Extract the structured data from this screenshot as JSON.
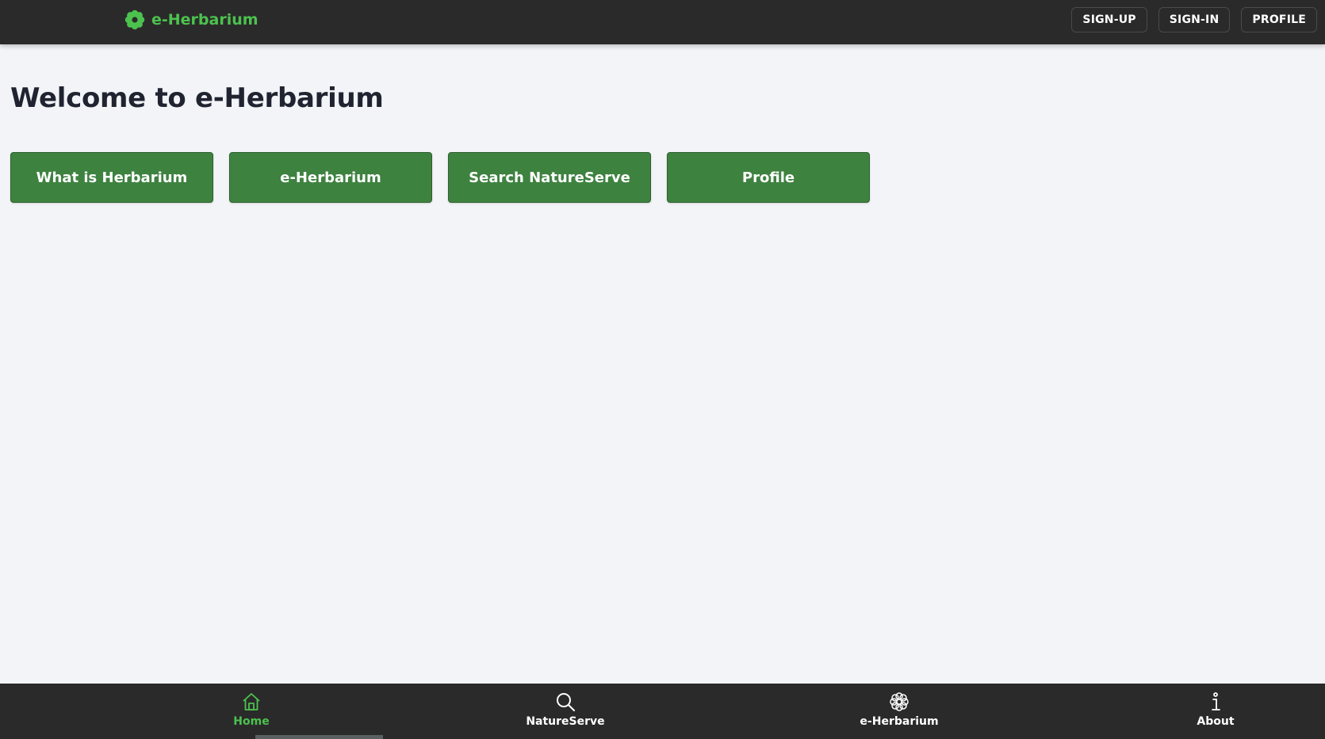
{
  "header": {
    "brand": "e-Herbarium",
    "buttons": {
      "signup": "SIGN-UP",
      "signin": "SIGN-IN",
      "profile": "PROFILE"
    }
  },
  "main": {
    "title": "Welcome to e-Herbarium",
    "actions": [
      "What is Herbarium",
      "e-Herbarium",
      "Search NatureServe",
      "Profile"
    ]
  },
  "bottom_nav": [
    {
      "label": "Home",
      "icon": "home-icon",
      "active": true
    },
    {
      "label": "NatureServe",
      "icon": "search-icon",
      "active": false
    },
    {
      "label": "e-Herbarium",
      "icon": "flower-icon",
      "active": false
    },
    {
      "label": "About",
      "icon": "info-icon",
      "active": false
    }
  ],
  "colors": {
    "accent": "#4cc24e",
    "button_green": "#3e8240",
    "bar_dark": "#2b2a2b",
    "background": "#f2f4f7"
  }
}
